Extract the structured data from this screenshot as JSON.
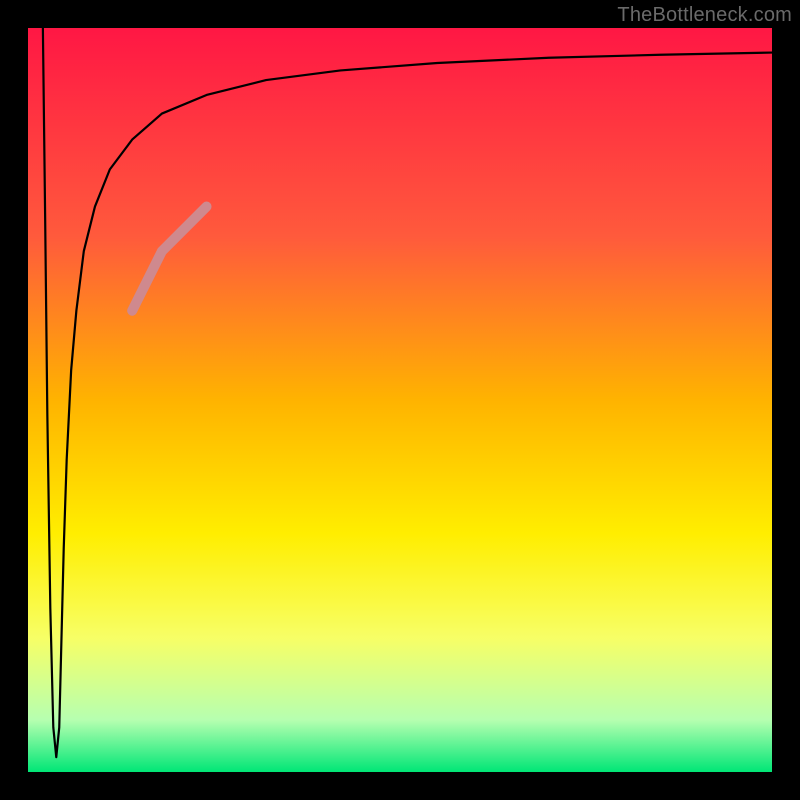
{
  "watermark": "TheBottleneck.com",
  "chart_data": {
    "type": "line",
    "title": "",
    "xlabel": "",
    "ylabel": "",
    "xlim": [
      0,
      100
    ],
    "ylim": [
      0,
      100
    ],
    "grid": false,
    "legend": false,
    "gradient_stops": [
      {
        "offset": 0.0,
        "color": "#ff1744"
      },
      {
        "offset": 0.28,
        "color": "#ff5a3c"
      },
      {
        "offset": 0.5,
        "color": "#ffb300"
      },
      {
        "offset": 0.68,
        "color": "#ffee00"
      },
      {
        "offset": 0.82,
        "color": "#f7ff66"
      },
      {
        "offset": 0.93,
        "color": "#b6ffb0"
      },
      {
        "offset": 1.0,
        "color": "#00e676"
      }
    ],
    "series": [
      {
        "name": "bottleneck-curve",
        "stroke": "#000000",
        "stroke_width": 2.2,
        "x": [
          2.0,
          2.3,
          2.6,
          3.0,
          3.4,
          3.8,
          4.2,
          4.5,
          4.8,
          5.2,
          5.8,
          6.5,
          7.5,
          9.0,
          11.0,
          14.0,
          18.0,
          24.0,
          32.0,
          42.0,
          55.0,
          70.0,
          85.0,
          100.0
        ],
        "y": [
          100.0,
          75.0,
          48.0,
          22.0,
          6.0,
          2.0,
          6.0,
          18.0,
          30.0,
          42.0,
          54.0,
          62.0,
          70.0,
          76.0,
          81.0,
          85.0,
          88.5,
          91.0,
          93.0,
          94.3,
          95.3,
          96.0,
          96.4,
          96.7
        ]
      }
    ],
    "highlight_segment": {
      "stroke": "#cf898e",
      "stroke_width": 10,
      "x": [
        14.0,
        18.0,
        24.0
      ],
      "y": [
        62.0,
        70.0,
        76.0
      ]
    }
  }
}
